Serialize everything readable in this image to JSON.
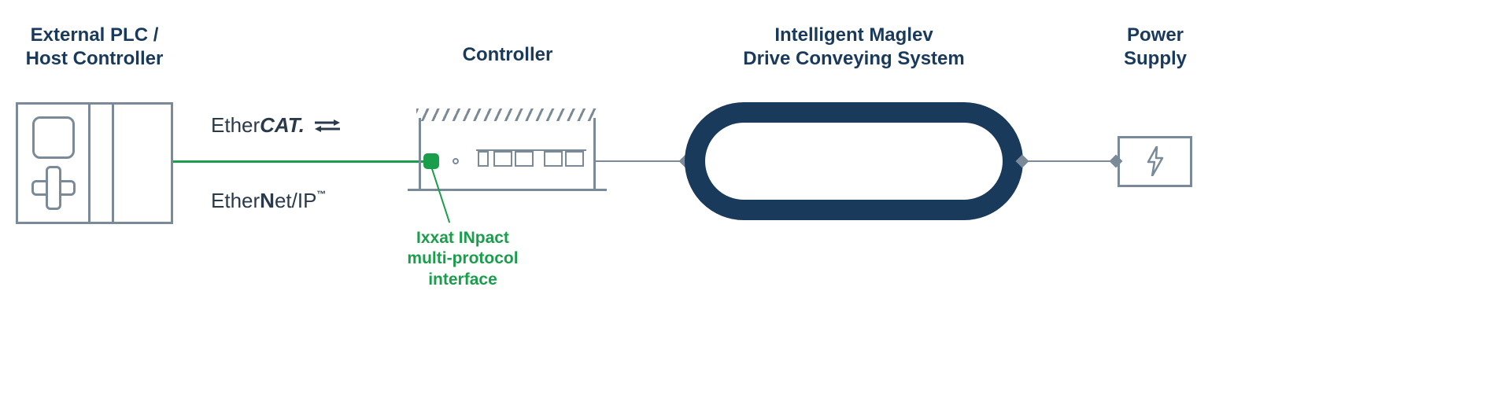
{
  "titles": {
    "plc_line1": "External PLC /",
    "plc_line2": "Host Controller",
    "controller": "Controller",
    "maglev_line1": "Intelligent Maglev",
    "maglev_line2": "Drive Conveying System",
    "psu_line1": "Power",
    "psu_line2": "Supply"
  },
  "protocols": {
    "ethercat_prefix": "Ether",
    "ethercat_suffix": "CAT.",
    "ethernetip_prefix": "Ether",
    "ethernetip_mid": "N",
    "ethernetip_mid2": "et/IP",
    "ethernetip_tm": "™"
  },
  "inpact": {
    "line1": "Ixxat INpact",
    "line2": "multi-protocol",
    "line3": "interface"
  },
  "colors": {
    "title": "#1a3a5c",
    "line": "#7a8a99",
    "green": "#1a9e4b",
    "oval": "#1a3a5c"
  }
}
